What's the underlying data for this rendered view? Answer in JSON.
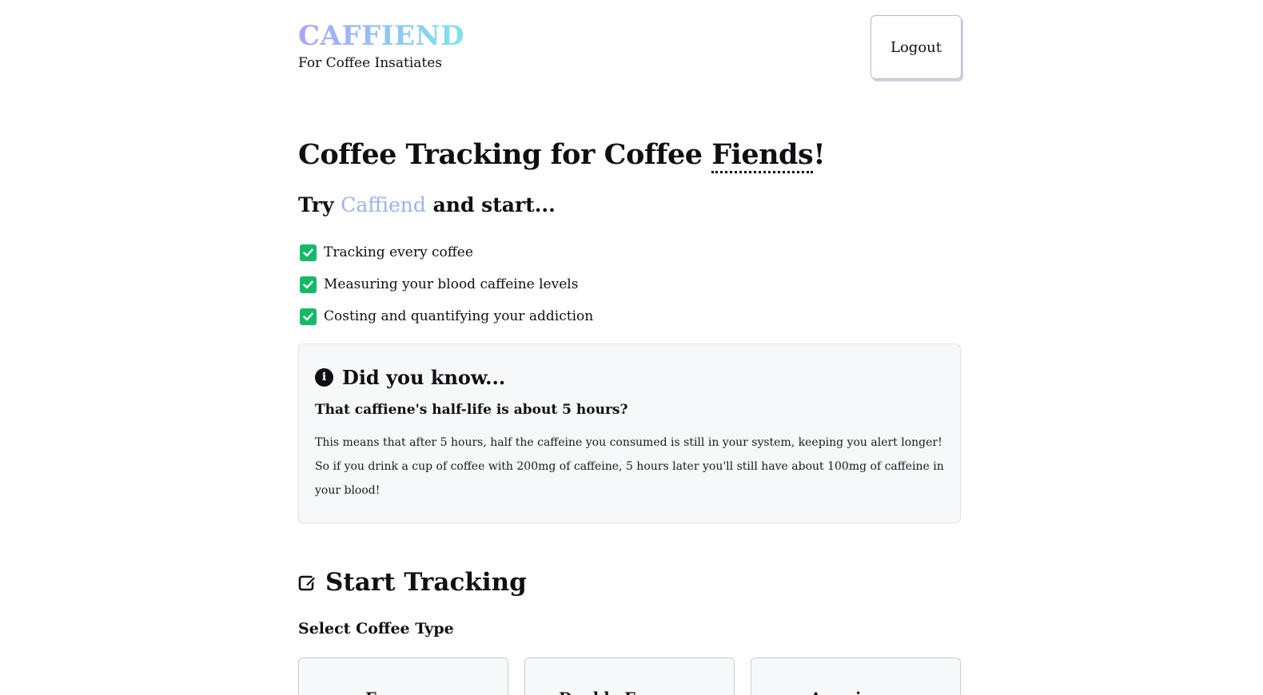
{
  "header": {
    "brand_title": "CAFFIEND",
    "brand_subtitle": "For Coffee Insatiates",
    "logout_label": "Logout"
  },
  "hero": {
    "title_prefix": "Coffee Tracking for Coffee ",
    "title_emphasis": "Fiends",
    "title_suffix": "!",
    "try_prefix": "Try ",
    "try_brand": "Caffiend",
    "try_suffix": " and start..."
  },
  "features": [
    {
      "label": "Tracking every coffee",
      "icon": "check-square-icon"
    },
    {
      "label": "Measuring your blood caffeine levels",
      "icon": "check-square-icon"
    },
    {
      "label": "Costing and quantifying your addiction",
      "icon": "check-square-icon"
    }
  ],
  "did_you_know": {
    "icon": "info-circle-icon",
    "title": "Did you know...",
    "subtitle": "That caffiene's half-life is about 5 hours?",
    "body": "This means that after 5 hours, half the caffeine you consumed is still in your system, keeping you alert longer! So if you drink a cup of coffee with 200mg of caffeine, 5 hours later you'll still have about 100mg of caffeine in your blood!"
  },
  "tracking": {
    "icon": "edit-icon",
    "title": "Start Tracking",
    "select_label": "Select Coffee Type",
    "coffee_types": [
      "Espresso",
      "Double Espresso",
      "Americano"
    ]
  },
  "colors": {
    "brand_gradient_start": "#a8a4f5",
    "brand_gradient_end": "#7ee3ec",
    "accent_text": "#9cb3ec",
    "check_green": "#16b96a",
    "card_background": "#f7f8fa"
  }
}
